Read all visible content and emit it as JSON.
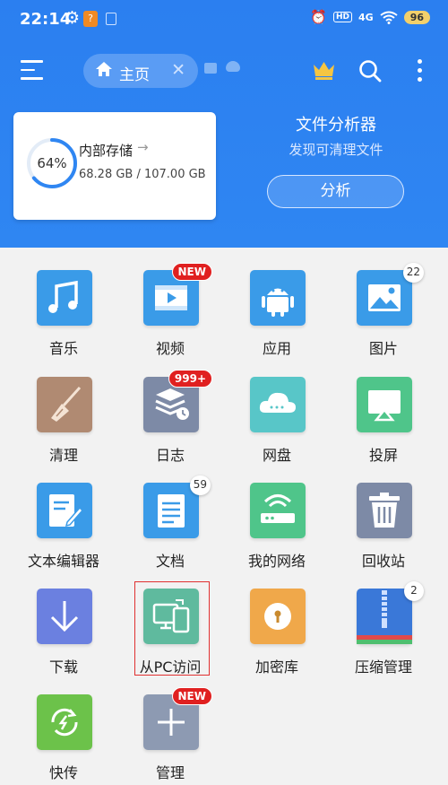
{
  "status_bar": {
    "time": "22:14",
    "hd": "HD",
    "network": "4G",
    "battery": "96"
  },
  "toolbar": {
    "home_tab_label": "主页"
  },
  "storage": {
    "percent_label": "64%",
    "percent_value": 0.64,
    "title": "内部存储",
    "size": "68.28 GB / 107.00 GB"
  },
  "analyzer": {
    "title": "文件分析器",
    "subtitle": "发现可清理文件",
    "button_label": "分析"
  },
  "tiles": [
    {
      "label": "音乐",
      "icon": "music-icon",
      "color": "#3a9be8"
    },
    {
      "label": "视频",
      "icon": "video-icon",
      "color": "#3a9be8",
      "badge": "NEW"
    },
    {
      "label": "应用",
      "icon": "android-icon",
      "color": "#3a9be8"
    },
    {
      "label": "图片",
      "icon": "image-icon",
      "color": "#3a9be8",
      "count": "22"
    },
    {
      "label": "清理",
      "icon": "broom-icon",
      "color": "#b08a72"
    },
    {
      "label": "日志",
      "icon": "log-icon",
      "color": "#7d8aa6",
      "badge": "999+"
    },
    {
      "label": "网盘",
      "icon": "cloud-drive-icon",
      "color": "#58c6c8"
    },
    {
      "label": "投屏",
      "icon": "cast-icon",
      "color": "#4fc58a"
    },
    {
      "label": "文本编辑器",
      "icon": "text-editor-icon",
      "color": "#3a9be8"
    },
    {
      "label": "文档",
      "icon": "document-icon",
      "color": "#3a9be8",
      "count": "59"
    },
    {
      "label": "我的网络",
      "icon": "network-icon",
      "color": "#4fc58a"
    },
    {
      "label": "回收站",
      "icon": "trash-icon",
      "color": "#7d8aa6"
    },
    {
      "label": "下载",
      "icon": "download-icon",
      "color": "#6b80e0"
    },
    {
      "label": "从PC访问",
      "icon": "pc-access-icon",
      "color": "#5fba9e"
    },
    {
      "label": "加密库",
      "icon": "lock-icon",
      "color": "#f0a84a"
    },
    {
      "label": "压缩管理",
      "icon": "zip-icon",
      "color": "#3a78d8",
      "count": "2"
    },
    {
      "label": "快传",
      "icon": "quick-transfer-icon",
      "color": "#6cc24a"
    },
    {
      "label": "管理",
      "icon": "add-icon",
      "color": "#8d9ab2",
      "badge": "NEW"
    }
  ]
}
